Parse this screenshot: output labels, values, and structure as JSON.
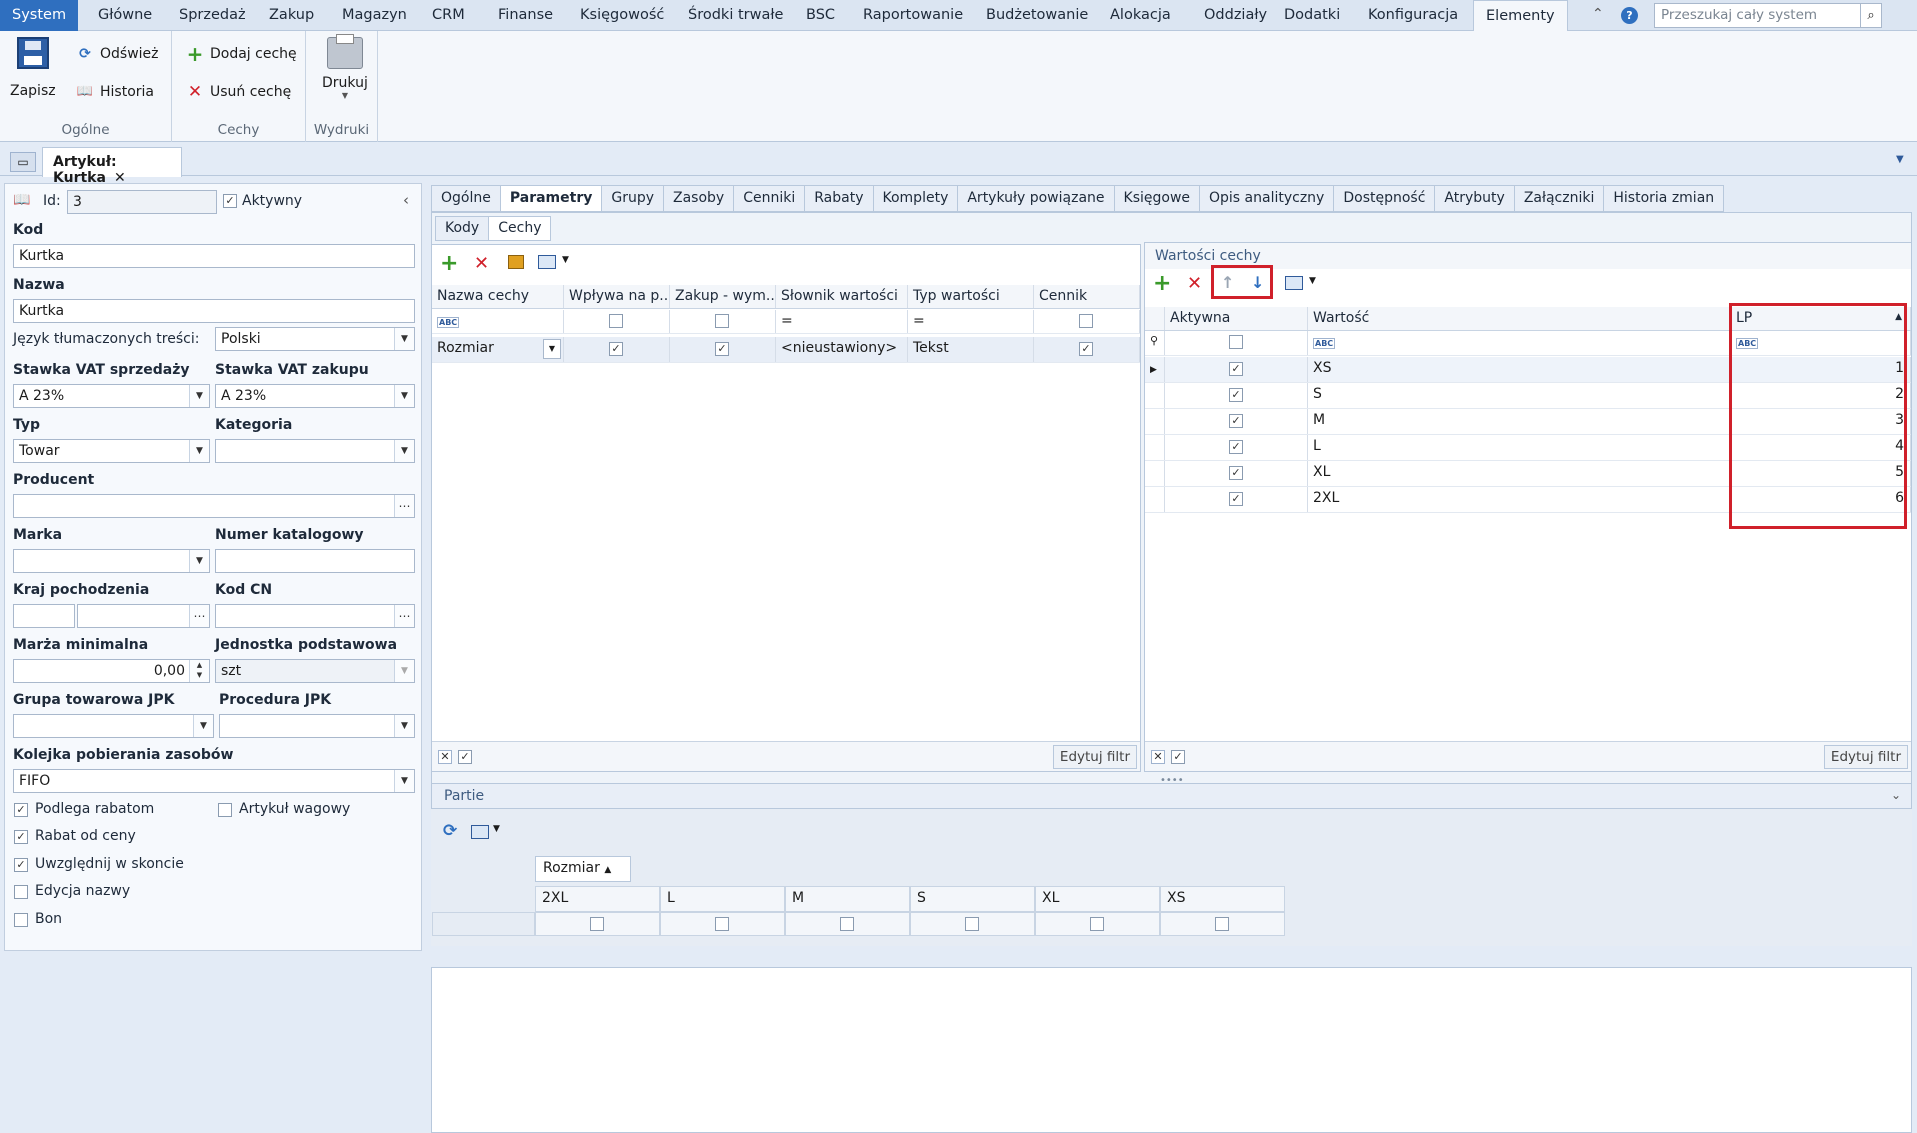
{
  "menu": {
    "tabs": [
      "System",
      "Główne",
      "Sprzedaż",
      "Zakup",
      "Magazyn",
      "CRM",
      "Finanse",
      "Księgowość",
      "Środki trwałe",
      "BSC",
      "Raportowanie",
      "Budżetowanie",
      "Alokacja",
      "Oddziały",
      "Dodatki",
      "Konfiguracja",
      "Elementy"
    ],
    "search_placeholder": "Przeszukaj cały system"
  },
  "ribbon": {
    "save": "Zapisz",
    "refresh": "Odśwież",
    "history": "Historia",
    "group_general": "Ogólne",
    "add_feature": "Dodaj cechę",
    "remove_feature": "Usuń cechę",
    "group_features": "Cechy",
    "print": "Drukuj",
    "group_prints": "Wydruki"
  },
  "doc_tab": {
    "title": "Artykuł: Kurtka"
  },
  "form": {
    "id_label": "Id:",
    "id_value": "3",
    "active_label": "Aktywny",
    "kod_label": "Kod",
    "kod_value": "Kurtka",
    "nazwa_label": "Nazwa",
    "nazwa_value": "Kurtka",
    "lang_label": "Język tłumaczonych treści:",
    "lang_value": "Polski",
    "vat_sale_label": "Stawka VAT sprzedaży",
    "vat_sale_value": "A 23%",
    "vat_buy_label": "Stawka VAT zakupu",
    "vat_buy_value": "A 23%",
    "typ_label": "Typ",
    "typ_value": "Towar",
    "kategoria_label": "Kategoria",
    "producent_label": "Producent",
    "marka_label": "Marka",
    "numer_label": "Numer katalogowy",
    "kraj_label": "Kraj pochodzenia",
    "kodcn_label": "Kod CN",
    "marza_label": "Marża minimalna",
    "marza_value": "0,00",
    "jednostka_label": "Jednostka podstawowa",
    "jednostka_value": "szt",
    "grupa_label": "Grupa towarowa JPK",
    "procedura_label": "Procedura JPK",
    "kolejka_label": "Kolejka pobierania zasobów",
    "kolejka_value": "FIFO",
    "cb_rabat": "Podlega rabatom",
    "cb_wagowy": "Artykuł wagowy",
    "cb_rabat_ceny": "Rabat od ceny",
    "cb_skonto": "Uwzględnij w skoncie",
    "cb_edycja": "Edycja nazwy",
    "cb_bon": "Bon"
  },
  "tabs": [
    "Ogólne",
    "Parametry",
    "Grupy",
    "Zasoby",
    "Cenniki",
    "Rabaty",
    "Komplety",
    "Artykuły powiązane",
    "Księgowe",
    "Opis analityczny",
    "Dostępność",
    "Atrybuty",
    "Załączniki",
    "Historia zmian"
  ],
  "subtabs": [
    "Kody",
    "Cechy"
  ],
  "features_grid": {
    "columns": [
      "Nazwa cechy",
      "Wpływa na p...",
      "Zakup - wym...",
      "Słownik wartości",
      "Typ wartości",
      "Cennik"
    ],
    "rows": [
      {
        "name": "Rozmiar",
        "dict": "<nieustawiony>",
        "type": "Tekst"
      }
    ],
    "edit_filter": "Edytuj filtr"
  },
  "values_panel": {
    "title": "Wartości cechy",
    "columns": [
      "Aktywna",
      "Wartość",
      "LP"
    ],
    "rows": [
      {
        "value": "XS",
        "lp": "1"
      },
      {
        "value": "S",
        "lp": "2"
      },
      {
        "value": "M",
        "lp": "3"
      },
      {
        "value": "L",
        "lp": "4"
      },
      {
        "value": "XL",
        "lp": "5"
      },
      {
        "value": "2XL",
        "lp": "6"
      }
    ],
    "edit_filter": "Edytuj filtr"
  },
  "partie": {
    "title": "Partie",
    "group_header": "Rozmiar",
    "columns": [
      "2XL",
      "L",
      "M",
      "S",
      "XL",
      "XS"
    ]
  },
  "colors": {
    "accent": "#2f6fbf",
    "highlight": "#d0202a"
  }
}
